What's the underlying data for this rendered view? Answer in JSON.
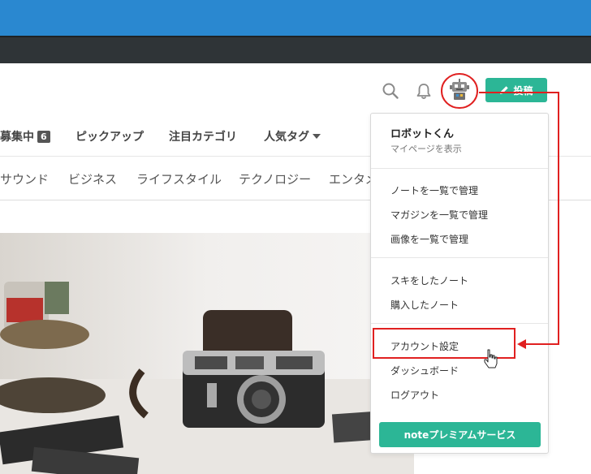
{
  "header": {
    "post_button_label": "投稿"
  },
  "nav": {
    "tabs": [
      {
        "label": "募集中",
        "badge": "6"
      },
      {
        "label": "ピックアップ"
      },
      {
        "label": "注目カテゴリ"
      },
      {
        "label": "人気タグ"
      }
    ]
  },
  "categories": [
    "サウンド",
    "ビジネス",
    "ライフスタイル",
    "テクノロジー",
    "エンタメ"
  ],
  "dropdown": {
    "user_name": "ロボットくん",
    "user_sub": "マイページを表示",
    "group1": [
      "ノートを一覧で管理",
      "マガジンを一覧で管理",
      "画像を一覧で管理"
    ],
    "group2": [
      "スキをしたノート",
      "購入したノート"
    ],
    "group3": [
      "アカウント設定",
      "ダッシュボード",
      "ログアウト"
    ],
    "premium_button_label": "noteプレミアムサービス"
  },
  "colors": {
    "accent": "#2cb696",
    "browser_top": "#2a88d0",
    "annotation": "#e02020"
  }
}
